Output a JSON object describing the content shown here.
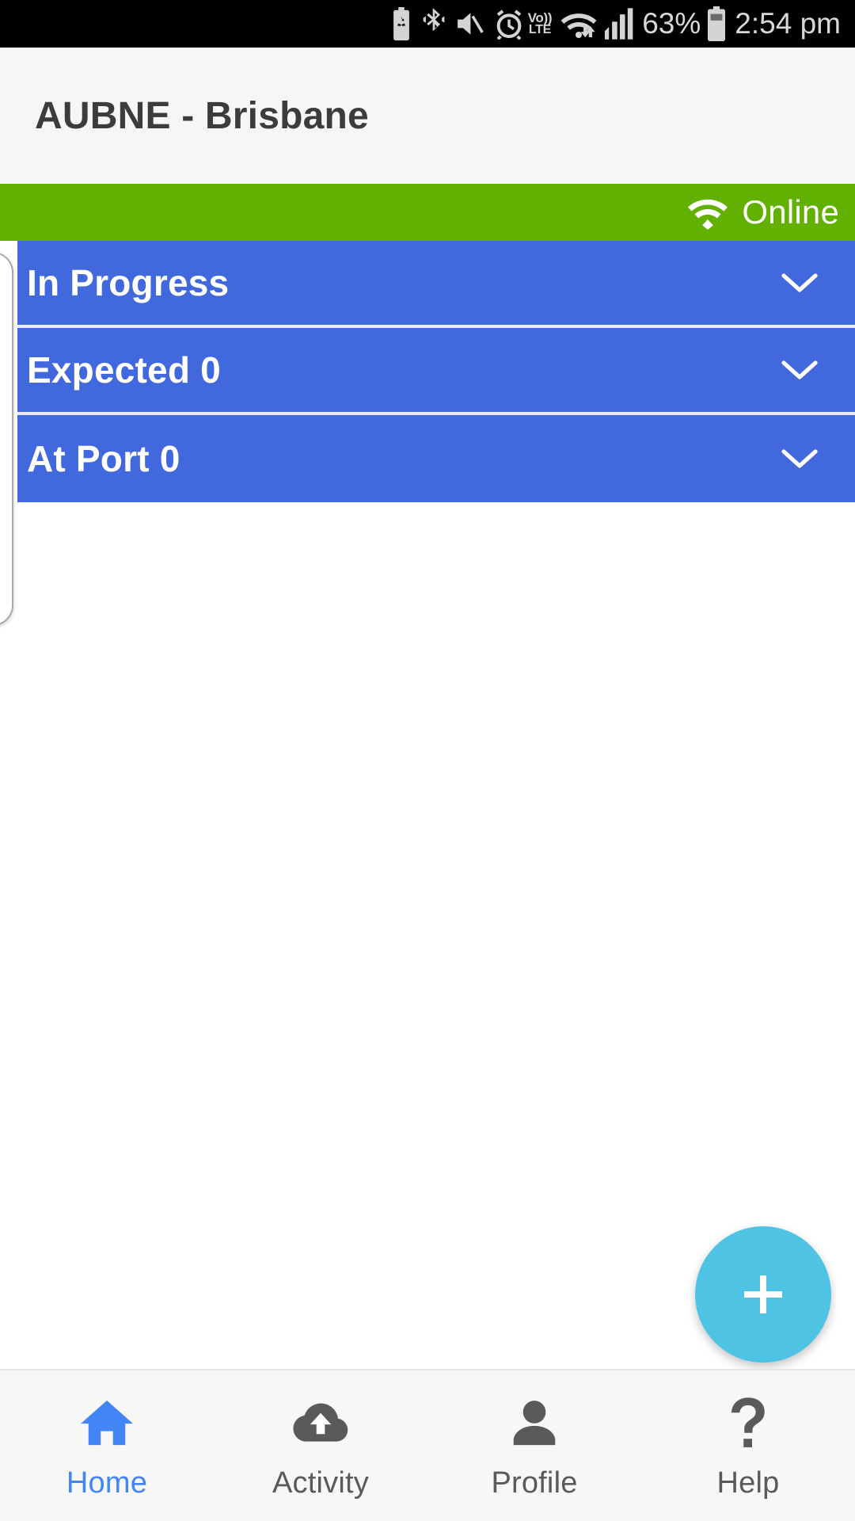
{
  "status_bar": {
    "icons": [
      "battery-saver-icon",
      "bluetooth-icon",
      "mute-icon",
      "alarm-icon",
      "volte-icon",
      "wifi-transfer-icon",
      "cellular-signal-icon",
      "battery-icon"
    ],
    "volte_line1": "Vo))",
    "volte_line2": "LTE",
    "battery_percent": "63%",
    "time": "2:54 pm"
  },
  "app_bar": {
    "title": "AUBNE - Brisbane"
  },
  "connection_banner": {
    "status_label": "Online",
    "icon": "wifi-icon",
    "color": "#61b002"
  },
  "accordion": {
    "accent_color": "#4268dd",
    "rows": [
      {
        "label": "In Progress",
        "chevron": "chevron-down-icon"
      },
      {
        "label": "Expected 0",
        "chevron": "chevron-down-icon"
      },
      {
        "label": "At Port 0",
        "chevron": "chevron-down-icon"
      }
    ]
  },
  "fab": {
    "icon": "plus-icon",
    "color": "#4fc3e3"
  },
  "bottom_nav": {
    "active_color": "#4285f4",
    "inactive_color": "#5a5a5a",
    "items": [
      {
        "label": "Home",
        "icon": "home-icon"
      },
      {
        "label": "Activity",
        "icon": "cloud-upload-icon"
      },
      {
        "label": "Profile",
        "icon": "person-icon"
      },
      {
        "label": "Help",
        "icon": "question-mark-icon"
      }
    ]
  }
}
